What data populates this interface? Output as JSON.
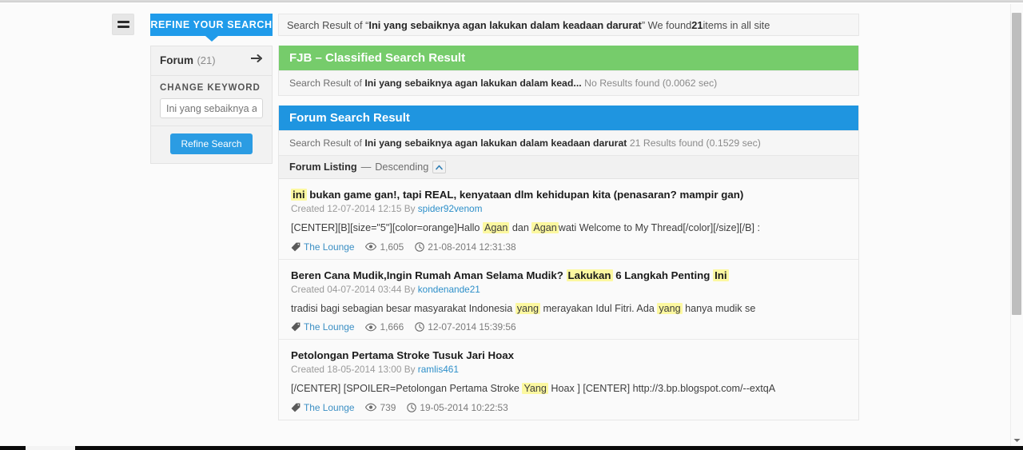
{
  "window": {
    "menu_icon": "hamburger-icon"
  },
  "sidebar": {
    "tab_label": "REFINE YOUR SEARCH",
    "forum_label": "Forum",
    "forum_count": "(21)",
    "arrow_icon": "arrow-right-icon",
    "change_keyword_label": "CHANGE KEYWORD",
    "keyword_placeholder": "Ini yang sebaiknya agan lakukan dalam keadaan darurat",
    "keyword_value": "",
    "refine_button": "Refine Search"
  },
  "topbar": {
    "prefix": "Search Result of “",
    "query": "Ini yang sebaiknya agan lakukan dalam keadaan darurat",
    "middle": "” We found ",
    "count": "21",
    "suffix": " items in all site"
  },
  "fjb_panel": {
    "heading": "FJB – Classified Search Result",
    "sub_prefix": "Search Result of ",
    "sub_query": "Ini yang sebaiknya agan lakukan dalam kead...",
    "sub_status": "No Results found (0.0062 sec)",
    "accent": "#76cc6b"
  },
  "forum_panel": {
    "heading": "Forum Search Result",
    "sub_prefix": "Search Result of ",
    "sub_query": "Ini yang sebaiknya agan lakukan dalam keadaan darurat",
    "sub_status": "21 Results found (0.1529 sec)",
    "accent": "#1f95e0",
    "listing_label": "Forum Listing",
    "listing_sep": "—",
    "listing_order": "Descending",
    "sort_icon": "chevron-up-icon"
  },
  "results": [
    {
      "title_parts": [
        {
          "text": "ini",
          "highlight": true
        },
        {
          "text": " bukan game gan!, tapi REAL, kenyataan dlm kehidupan kita (penasaran? mampir gan)",
          "highlight": false
        }
      ],
      "created_label": "Created",
      "created_date": "12-07-2014 12:15",
      "by_label": "By",
      "author": "spider92venom",
      "snippet_parts": [
        {
          "text": "[CENTER][B][size=\"5\"][color=orange]Hallo ",
          "highlight": false
        },
        {
          "text": "Agan",
          "highlight": true
        },
        {
          "text": " dan ",
          "highlight": false
        },
        {
          "text": "Agan",
          "highlight": true
        },
        {
          "text": "wati Welcome to My Thread[/color][/size][/B] :",
          "highlight": false
        }
      ],
      "forum": "The Lounge",
      "views": "1,605",
      "timestamp": "21-08-2014 12:31:38",
      "tag_icon": "tag-icon",
      "views_icon": "eye-icon",
      "time_icon": "clock-icon"
    },
    {
      "title_parts": [
        {
          "text": "Beren Cana Mudik,Ingin Rumah Aman Selama Mudik? ",
          "highlight": false
        },
        {
          "text": "Lakukan",
          "highlight": true
        },
        {
          "text": " 6 Langkah Penting ",
          "highlight": false
        },
        {
          "text": "Ini",
          "highlight": true
        }
      ],
      "created_label": "Created",
      "created_date": "04-07-2014 03:44",
      "by_label": "By",
      "author": "kondenande21",
      "snippet_parts": [
        {
          "text": "tradisi bagi sebagian besar masyarakat Indonesia ",
          "highlight": false
        },
        {
          "text": "yang",
          "highlight": true
        },
        {
          "text": " merayakan Idul Fitri. Ada ",
          "highlight": false
        },
        {
          "text": "yang",
          "highlight": true
        },
        {
          "text": " hanya mudik se",
          "highlight": false
        }
      ],
      "forum": "The Lounge",
      "views": "1,666",
      "timestamp": "12-07-2014 15:39:56",
      "tag_icon": "tag-icon",
      "views_icon": "eye-icon",
      "time_icon": "clock-icon"
    },
    {
      "title_parts": [
        {
          "text": "Petolongan Pertama Stroke Tusuk Jari Hoax",
          "highlight": false
        }
      ],
      "created_label": "Created",
      "created_date": "18-05-2014 13:00",
      "by_label": "By",
      "author": "ramlis461",
      "snippet_parts": [
        {
          "text": "[/CENTER] [SPOILER=Petolongan Pertama Stroke ",
          "highlight": false
        },
        {
          "text": "Yang",
          "highlight": true
        },
        {
          "text": " Hoax ] [CENTER] http://3.bp.blogspot.com/--extqA",
          "highlight": false
        }
      ],
      "forum": "The Lounge",
      "views": "739",
      "timestamp": "19-05-2014 10:22:53",
      "tag_icon": "tag-icon",
      "views_icon": "eye-icon",
      "time_icon": "clock-icon"
    }
  ],
  "scrollbar": {
    "down_arrow_icon": "chevron-down-icon"
  }
}
